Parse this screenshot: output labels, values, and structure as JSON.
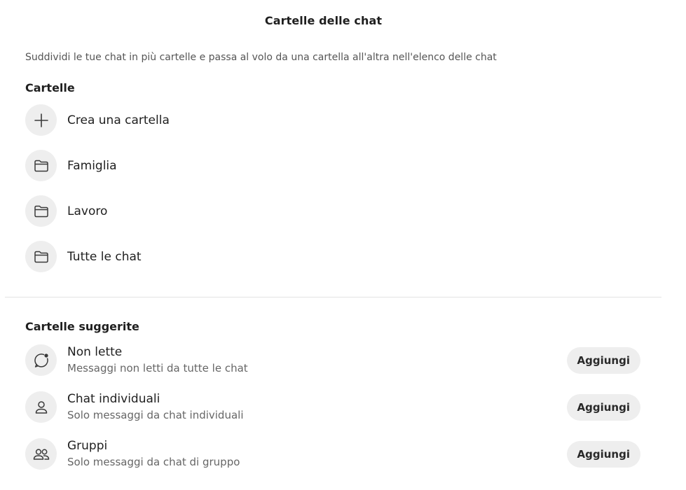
{
  "header": {
    "title": "Cartelle delle chat"
  },
  "description": "Suddividi le tue chat in più cartelle e passa al volo da una cartella all'altra nell'elenco delle chat",
  "folders": {
    "section_title": "Cartelle",
    "create_label": "Crea una cartella",
    "items": [
      {
        "label": "Famiglia",
        "icon": "folder-icon"
      },
      {
        "label": "Lavoro",
        "icon": "folder-icon"
      },
      {
        "label": "Tutte le chat",
        "icon": "folder-icon"
      }
    ]
  },
  "suggested": {
    "section_title": "Cartelle suggerite",
    "items": [
      {
        "name": "Non lette",
        "description": "Messaggi non letti da tutte le chat",
        "icon": "unread-chat-icon",
        "button": "Aggiungi"
      },
      {
        "name": "Chat individuali",
        "description": "Solo messaggi da chat individuali",
        "icon": "person-icon",
        "button": "Aggiungi"
      },
      {
        "name": "Gruppi",
        "description": "Solo messaggi da chat di gruppo",
        "icon": "group-icon",
        "button": "Aggiungi"
      }
    ]
  },
  "colors": {
    "icon_background": "#eeeeee",
    "divider": "#e2e2e2",
    "secondary_text": "#666666"
  }
}
